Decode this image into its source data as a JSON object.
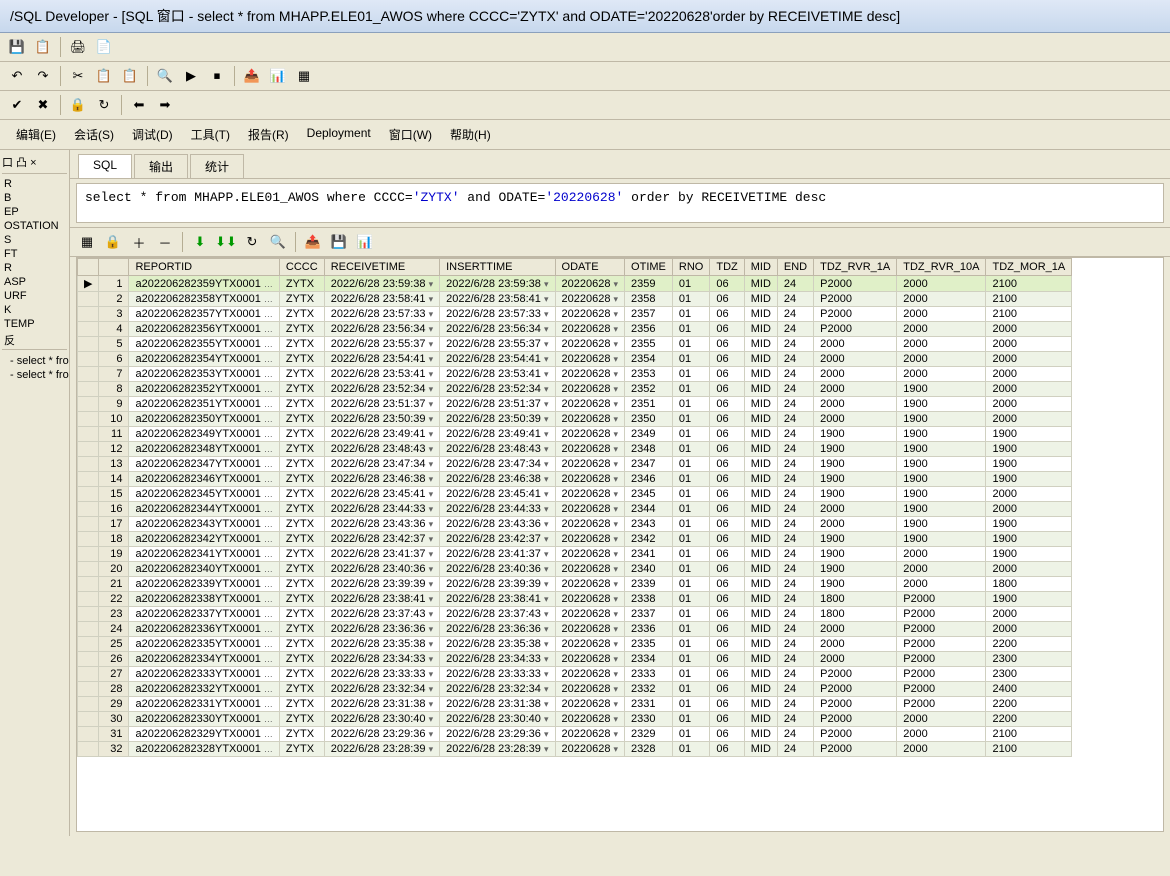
{
  "title": "/SQL Developer - [SQL 窗口 - select * from MHAPP.ELE01_AWOS where CCCC='ZYTX' and ODATE='20220628'order by RECEIVETIME desc]",
  "menus": [
    "编辑(E)",
    "会话(S)",
    "调试(D)",
    "工具(T)",
    "报告(R)",
    "Deployment",
    "窗口(W)",
    "帮助(H)"
  ],
  "tabs": [
    "SQL",
    "输出",
    "统计"
  ],
  "sql_parts": {
    "p1": "select *",
    "p2": " from ",
    "p3": "MHAPP.ELE01_AWOS",
    "p4": " where CCCC=",
    "s1": "'ZYTX'",
    "p5": " and ODATE=",
    "s2": "'20220628'",
    "p6": " order by RECEIVETIME ",
    "p7": "desc"
  },
  "columns": [
    "REPORTID",
    "CCCC",
    "RECEIVETIME",
    "INSERTTIME",
    "ODATE",
    "OTIME",
    "RNO",
    "TDZ",
    "MID",
    "END",
    "TDZ_RVR_1A",
    "TDZ_RVR_10A",
    "TDZ_MOR_1A"
  ],
  "rows": [
    {
      "n": 1,
      "ptr": "▶",
      "REPORTID": "a202206282359YTX0001",
      "CCCC": "ZYTX",
      "RECEIVETIME": "2022/6/28 23:59:38",
      "INSERTTIME": "2022/6/28 23:59:38",
      "ODATE": "20220628",
      "OTIME": "2359",
      "RNO": "01",
      "TDZ": "06",
      "MID": "MID",
      "END": "24",
      "TDZ_RVR_1A": "P2000",
      "TDZ_RVR_10A": "2000",
      "TDZ_MOR_1A": "2100",
      "hl": true
    },
    {
      "n": 2,
      "REPORTID": "a202206282358YTX0001",
      "CCCC": "ZYTX",
      "RECEIVETIME": "2022/6/28 23:58:41",
      "INSERTTIME": "2022/6/28 23:58:41",
      "ODATE": "20220628",
      "OTIME": "2358",
      "RNO": "01",
      "TDZ": "06",
      "MID": "MID",
      "END": "24",
      "TDZ_RVR_1A": "P2000",
      "TDZ_RVR_10A": "2000",
      "TDZ_MOR_1A": "2100"
    },
    {
      "n": 3,
      "REPORTID": "a202206282357YTX0001",
      "CCCC": "ZYTX",
      "RECEIVETIME": "2022/6/28 23:57:33",
      "INSERTTIME": "2022/6/28 23:57:33",
      "ODATE": "20220628",
      "OTIME": "2357",
      "RNO": "01",
      "TDZ": "06",
      "MID": "MID",
      "END": "24",
      "TDZ_RVR_1A": "P2000",
      "TDZ_RVR_10A": "2000",
      "TDZ_MOR_1A": "2100"
    },
    {
      "n": 4,
      "REPORTID": "a202206282356YTX0001",
      "CCCC": "ZYTX",
      "RECEIVETIME": "2022/6/28 23:56:34",
      "INSERTTIME": "2022/6/28 23:56:34",
      "ODATE": "20220628",
      "OTIME": "2356",
      "RNO": "01",
      "TDZ": "06",
      "MID": "MID",
      "END": "24",
      "TDZ_RVR_1A": "P2000",
      "TDZ_RVR_10A": "2000",
      "TDZ_MOR_1A": "2000"
    },
    {
      "n": 5,
      "REPORTID": "a202206282355YTX0001",
      "CCCC": "ZYTX",
      "RECEIVETIME": "2022/6/28 23:55:37",
      "INSERTTIME": "2022/6/28 23:55:37",
      "ODATE": "20220628",
      "OTIME": "2355",
      "RNO": "01",
      "TDZ": "06",
      "MID": "MID",
      "END": "24",
      "TDZ_RVR_1A": "2000",
      "TDZ_RVR_10A": "2000",
      "TDZ_MOR_1A": "2000"
    },
    {
      "n": 6,
      "REPORTID": "a202206282354YTX0001",
      "CCCC": "ZYTX",
      "RECEIVETIME": "2022/6/28 23:54:41",
      "INSERTTIME": "2022/6/28 23:54:41",
      "ODATE": "20220628",
      "OTIME": "2354",
      "RNO": "01",
      "TDZ": "06",
      "MID": "MID",
      "END": "24",
      "TDZ_RVR_1A": "2000",
      "TDZ_RVR_10A": "2000",
      "TDZ_MOR_1A": "2000"
    },
    {
      "n": 7,
      "REPORTID": "a202206282353YTX0001",
      "CCCC": "ZYTX",
      "RECEIVETIME": "2022/6/28 23:53:41",
      "INSERTTIME": "2022/6/28 23:53:41",
      "ODATE": "20220628",
      "OTIME": "2353",
      "RNO": "01",
      "TDZ": "06",
      "MID": "MID",
      "END": "24",
      "TDZ_RVR_1A": "2000",
      "TDZ_RVR_10A": "2000",
      "TDZ_MOR_1A": "2000"
    },
    {
      "n": 8,
      "REPORTID": "a202206282352YTX0001",
      "CCCC": "ZYTX",
      "RECEIVETIME": "2022/6/28 23:52:34",
      "INSERTTIME": "2022/6/28 23:52:34",
      "ODATE": "20220628",
      "OTIME": "2352",
      "RNO": "01",
      "TDZ": "06",
      "MID": "MID",
      "END": "24",
      "TDZ_RVR_1A": "2000",
      "TDZ_RVR_10A": "1900",
      "TDZ_MOR_1A": "2000"
    },
    {
      "n": 9,
      "REPORTID": "a202206282351YTX0001",
      "CCCC": "ZYTX",
      "RECEIVETIME": "2022/6/28 23:51:37",
      "INSERTTIME": "2022/6/28 23:51:37",
      "ODATE": "20220628",
      "OTIME": "2351",
      "RNO": "01",
      "TDZ": "06",
      "MID": "MID",
      "END": "24",
      "TDZ_RVR_1A": "2000",
      "TDZ_RVR_10A": "1900",
      "TDZ_MOR_1A": "2000"
    },
    {
      "n": 10,
      "REPORTID": "a202206282350YTX0001",
      "CCCC": "ZYTX",
      "RECEIVETIME": "2022/6/28 23:50:39",
      "INSERTTIME": "2022/6/28 23:50:39",
      "ODATE": "20220628",
      "OTIME": "2350",
      "RNO": "01",
      "TDZ": "06",
      "MID": "MID",
      "END": "24",
      "TDZ_RVR_1A": "2000",
      "TDZ_RVR_10A": "1900",
      "TDZ_MOR_1A": "2000"
    },
    {
      "n": 11,
      "REPORTID": "a202206282349YTX0001",
      "CCCC": "ZYTX",
      "RECEIVETIME": "2022/6/28 23:49:41",
      "INSERTTIME": "2022/6/28 23:49:41",
      "ODATE": "20220628",
      "OTIME": "2349",
      "RNO": "01",
      "TDZ": "06",
      "MID": "MID",
      "END": "24",
      "TDZ_RVR_1A": "1900",
      "TDZ_RVR_10A": "1900",
      "TDZ_MOR_1A": "1900"
    },
    {
      "n": 12,
      "REPORTID": "a202206282348YTX0001",
      "CCCC": "ZYTX",
      "RECEIVETIME": "2022/6/28 23:48:43",
      "INSERTTIME": "2022/6/28 23:48:43",
      "ODATE": "20220628",
      "OTIME": "2348",
      "RNO": "01",
      "TDZ": "06",
      "MID": "MID",
      "END": "24",
      "TDZ_RVR_1A": "1900",
      "TDZ_RVR_10A": "1900",
      "TDZ_MOR_1A": "1900"
    },
    {
      "n": 13,
      "REPORTID": "a202206282347YTX0001",
      "CCCC": "ZYTX",
      "RECEIVETIME": "2022/6/28 23:47:34",
      "INSERTTIME": "2022/6/28 23:47:34",
      "ODATE": "20220628",
      "OTIME": "2347",
      "RNO": "01",
      "TDZ": "06",
      "MID": "MID",
      "END": "24",
      "TDZ_RVR_1A": "1900",
      "TDZ_RVR_10A": "1900",
      "TDZ_MOR_1A": "1900"
    },
    {
      "n": 14,
      "REPORTID": "a202206282346YTX0001",
      "CCCC": "ZYTX",
      "RECEIVETIME": "2022/6/28 23:46:38",
      "INSERTTIME": "2022/6/28 23:46:38",
      "ODATE": "20220628",
      "OTIME": "2346",
      "RNO": "01",
      "TDZ": "06",
      "MID": "MID",
      "END": "24",
      "TDZ_RVR_1A": "1900",
      "TDZ_RVR_10A": "1900",
      "TDZ_MOR_1A": "1900"
    },
    {
      "n": 15,
      "REPORTID": "a202206282345YTX0001",
      "CCCC": "ZYTX",
      "RECEIVETIME": "2022/6/28 23:45:41",
      "INSERTTIME": "2022/6/28 23:45:41",
      "ODATE": "20220628",
      "OTIME": "2345",
      "RNO": "01",
      "TDZ": "06",
      "MID": "MID",
      "END": "24",
      "TDZ_RVR_1A": "1900",
      "TDZ_RVR_10A": "1900",
      "TDZ_MOR_1A": "2000"
    },
    {
      "n": 16,
      "REPORTID": "a202206282344YTX0001",
      "CCCC": "ZYTX",
      "RECEIVETIME": "2022/6/28 23:44:33",
      "INSERTTIME": "2022/6/28 23:44:33",
      "ODATE": "20220628",
      "OTIME": "2344",
      "RNO": "01",
      "TDZ": "06",
      "MID": "MID",
      "END": "24",
      "TDZ_RVR_1A": "2000",
      "TDZ_RVR_10A": "1900",
      "TDZ_MOR_1A": "2000"
    },
    {
      "n": 17,
      "REPORTID": "a202206282343YTX0001",
      "CCCC": "ZYTX",
      "RECEIVETIME": "2022/6/28 23:43:36",
      "INSERTTIME": "2022/6/28 23:43:36",
      "ODATE": "20220628",
      "OTIME": "2343",
      "RNO": "01",
      "TDZ": "06",
      "MID": "MID",
      "END": "24",
      "TDZ_RVR_1A": "2000",
      "TDZ_RVR_10A": "1900",
      "TDZ_MOR_1A": "1900"
    },
    {
      "n": 18,
      "REPORTID": "a202206282342YTX0001",
      "CCCC": "ZYTX",
      "RECEIVETIME": "2022/6/28 23:42:37",
      "INSERTTIME": "2022/6/28 23:42:37",
      "ODATE": "20220628",
      "OTIME": "2342",
      "RNO": "01",
      "TDZ": "06",
      "MID": "MID",
      "END": "24",
      "TDZ_RVR_1A": "1900",
      "TDZ_RVR_10A": "1900",
      "TDZ_MOR_1A": "1900"
    },
    {
      "n": 19,
      "REPORTID": "a202206282341YTX0001",
      "CCCC": "ZYTX",
      "RECEIVETIME": "2022/6/28 23:41:37",
      "INSERTTIME": "2022/6/28 23:41:37",
      "ODATE": "20220628",
      "OTIME": "2341",
      "RNO": "01",
      "TDZ": "06",
      "MID": "MID",
      "END": "24",
      "TDZ_RVR_1A": "1900",
      "TDZ_RVR_10A": "2000",
      "TDZ_MOR_1A": "1900"
    },
    {
      "n": 20,
      "REPORTID": "a202206282340YTX0001",
      "CCCC": "ZYTX",
      "RECEIVETIME": "2022/6/28 23:40:36",
      "INSERTTIME": "2022/6/28 23:40:36",
      "ODATE": "20220628",
      "OTIME": "2340",
      "RNO": "01",
      "TDZ": "06",
      "MID": "MID",
      "END": "24",
      "TDZ_RVR_1A": "1900",
      "TDZ_RVR_10A": "2000",
      "TDZ_MOR_1A": "2000"
    },
    {
      "n": 21,
      "REPORTID": "a202206282339YTX0001",
      "CCCC": "ZYTX",
      "RECEIVETIME": "2022/6/28 23:39:39",
      "INSERTTIME": "2022/6/28 23:39:39",
      "ODATE": "20220628",
      "OTIME": "2339",
      "RNO": "01",
      "TDZ": "06",
      "MID": "MID",
      "END": "24",
      "TDZ_RVR_1A": "1900",
      "TDZ_RVR_10A": "2000",
      "TDZ_MOR_1A": "1800"
    },
    {
      "n": 22,
      "REPORTID": "a202206282338YTX0001",
      "CCCC": "ZYTX",
      "RECEIVETIME": "2022/6/28 23:38:41",
      "INSERTTIME": "2022/6/28 23:38:41",
      "ODATE": "20220628",
      "OTIME": "2338",
      "RNO": "01",
      "TDZ": "06",
      "MID": "MID",
      "END": "24",
      "TDZ_RVR_1A": "1800",
      "TDZ_RVR_10A": "P2000",
      "TDZ_MOR_1A": "1900"
    },
    {
      "n": 23,
      "REPORTID": "a202206282337YTX0001",
      "CCCC": "ZYTX",
      "RECEIVETIME": "2022/6/28 23:37:43",
      "INSERTTIME": "2022/6/28 23:37:43",
      "ODATE": "20220628",
      "OTIME": "2337",
      "RNO": "01",
      "TDZ": "06",
      "MID": "MID",
      "END": "24",
      "TDZ_RVR_1A": "1800",
      "TDZ_RVR_10A": "P2000",
      "TDZ_MOR_1A": "2000"
    },
    {
      "n": 24,
      "REPORTID": "a202206282336YTX0001",
      "CCCC": "ZYTX",
      "RECEIVETIME": "2022/6/28 23:36:36",
      "INSERTTIME": "2022/6/28 23:36:36",
      "ODATE": "20220628",
      "OTIME": "2336",
      "RNO": "01",
      "TDZ": "06",
      "MID": "MID",
      "END": "24",
      "TDZ_RVR_1A": "2000",
      "TDZ_RVR_10A": "P2000",
      "TDZ_MOR_1A": "2000"
    },
    {
      "n": 25,
      "REPORTID": "a202206282335YTX0001",
      "CCCC": "ZYTX",
      "RECEIVETIME": "2022/6/28 23:35:38",
      "INSERTTIME": "2022/6/28 23:35:38",
      "ODATE": "20220628",
      "OTIME": "2335",
      "RNO": "01",
      "TDZ": "06",
      "MID": "MID",
      "END": "24",
      "TDZ_RVR_1A": "2000",
      "TDZ_RVR_10A": "P2000",
      "TDZ_MOR_1A": "2200"
    },
    {
      "n": 26,
      "REPORTID": "a202206282334YTX0001",
      "CCCC": "ZYTX",
      "RECEIVETIME": "2022/6/28 23:34:33",
      "INSERTTIME": "2022/6/28 23:34:33",
      "ODATE": "20220628",
      "OTIME": "2334",
      "RNO": "01",
      "TDZ": "06",
      "MID": "MID",
      "END": "24",
      "TDZ_RVR_1A": "2000",
      "TDZ_RVR_10A": "P2000",
      "TDZ_MOR_1A": "2300"
    },
    {
      "n": 27,
      "REPORTID": "a202206282333YTX0001",
      "CCCC": "ZYTX",
      "RECEIVETIME": "2022/6/28 23:33:33",
      "INSERTTIME": "2022/6/28 23:33:33",
      "ODATE": "20220628",
      "OTIME": "2333",
      "RNO": "01",
      "TDZ": "06",
      "MID": "MID",
      "END": "24",
      "TDZ_RVR_1A": "P2000",
      "TDZ_RVR_10A": "P2000",
      "TDZ_MOR_1A": "2300"
    },
    {
      "n": 28,
      "REPORTID": "a202206282332YTX0001",
      "CCCC": "ZYTX",
      "RECEIVETIME": "2022/6/28 23:32:34",
      "INSERTTIME": "2022/6/28 23:32:34",
      "ODATE": "20220628",
      "OTIME": "2332",
      "RNO": "01",
      "TDZ": "06",
      "MID": "MID",
      "END": "24",
      "TDZ_RVR_1A": "P2000",
      "TDZ_RVR_10A": "P2000",
      "TDZ_MOR_1A": "2400"
    },
    {
      "n": 29,
      "REPORTID": "a202206282331YTX0001",
      "CCCC": "ZYTX",
      "RECEIVETIME": "2022/6/28 23:31:38",
      "INSERTTIME": "2022/6/28 23:31:38",
      "ODATE": "20220628",
      "OTIME": "2331",
      "RNO": "01",
      "TDZ": "06",
      "MID": "MID",
      "END": "24",
      "TDZ_RVR_1A": "P2000",
      "TDZ_RVR_10A": "P2000",
      "TDZ_MOR_1A": "2200"
    },
    {
      "n": 30,
      "REPORTID": "a202206282330YTX0001",
      "CCCC": "ZYTX",
      "RECEIVETIME": "2022/6/28 23:30:40",
      "INSERTTIME": "2022/6/28 23:30:40",
      "ODATE": "20220628",
      "OTIME": "2330",
      "RNO": "01",
      "TDZ": "06",
      "MID": "MID",
      "END": "24",
      "TDZ_RVR_1A": "P2000",
      "TDZ_RVR_10A": "2000",
      "TDZ_MOR_1A": "2200"
    },
    {
      "n": 31,
      "REPORTID": "a202206282329YTX0001",
      "CCCC": "ZYTX",
      "RECEIVETIME": "2022/6/28 23:29:36",
      "INSERTTIME": "2022/6/28 23:29:36",
      "ODATE": "20220628",
      "OTIME": "2329",
      "RNO": "01",
      "TDZ": "06",
      "MID": "MID",
      "END": "24",
      "TDZ_RVR_1A": "P2000",
      "TDZ_RVR_10A": "2000",
      "TDZ_MOR_1A": "2100"
    },
    {
      "n": 32,
      "REPORTID": "a202206282328YTX0001",
      "CCCC": "ZYTX",
      "RECEIVETIME": "2022/6/28 23:28:39",
      "INSERTTIME": "2022/6/28 23:28:39",
      "ODATE": "20220628",
      "OTIME": "2328",
      "RNO": "01",
      "TDZ": "06",
      "MID": "MID",
      "END": "24",
      "TDZ_RVR_1A": "P2000",
      "TDZ_RVR_10A": "2000",
      "TDZ_MOR_1A": "2100"
    }
  ],
  "tree": [
    "R",
    "B",
    "EP",
    "OSTATION",
    "S",
    "FT",
    "R",
    "ASP",
    "URF",
    "K",
    "TEMP",
    "反"
  ],
  "history": [
    "- select * from",
    "- select * from"
  ],
  "side_tabs_label": "口 凸 ×",
  "icons": {
    "save": "💾",
    "copy": "📋",
    "print": "🖨",
    "new": "📄",
    "undo": "↶",
    "redo": "↷",
    "cut": "✂",
    "paste": "📋",
    "find": "🔍",
    "exec": "▶",
    "stop": "⏹",
    "commit": "✔",
    "rollback": "✖",
    "lock": "🔒",
    "refresh": "↻",
    "export": "📤",
    "chart": "📊",
    "grid": "▦",
    "left": "⬅",
    "right": "➡",
    "add": "＋",
    "del": "－",
    "first": "⏮",
    "last": "⏭",
    "fetch_all": "⬇⬇",
    "fetch_page": "⬇"
  }
}
